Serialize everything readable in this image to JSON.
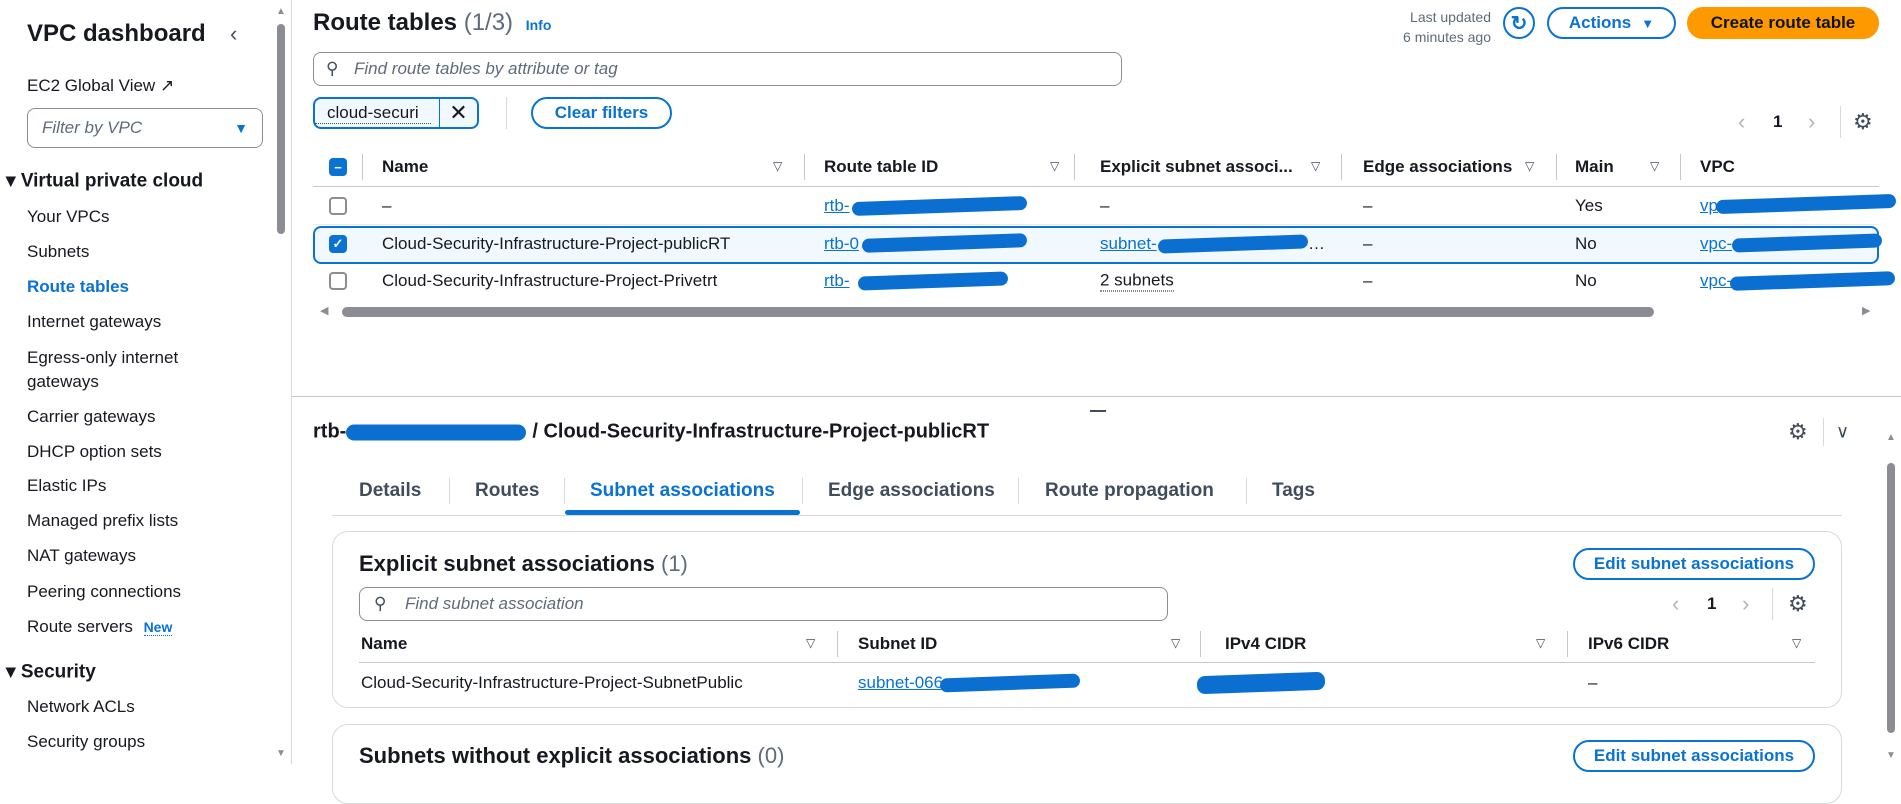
{
  "sidebar": {
    "title": "VPC dashboard",
    "ec2_global_view": "EC2 Global View",
    "filter_placeholder": "Filter by VPC",
    "section_vpc": "Virtual private cloud",
    "items": [
      "Your VPCs",
      "Subnets",
      "Route tables",
      "Internet gateways",
      "Egress-only internet",
      "gateways",
      "Carrier gateways",
      "DHCP option sets",
      "Elastic IPs",
      "Managed prefix lists",
      "NAT gateways",
      "Peering connections",
      "Route servers"
    ],
    "new_badge": "New",
    "section_security": "Security",
    "security_items": [
      "Network ACLs",
      "Security groups"
    ]
  },
  "header": {
    "title": "Route tables",
    "count": "(1/3)",
    "info": "Info",
    "last_updated_1": "Last updated",
    "last_updated_2": "6 minutes ago",
    "actions": "Actions",
    "create": "Create route table"
  },
  "search": {
    "placeholder": "Find route tables by attribute or tag"
  },
  "filter": {
    "chip": "cloud-securi",
    "clear": "Clear filters"
  },
  "pagination": {
    "page": "1"
  },
  "table": {
    "columns": [
      "Name",
      "Route table ID",
      "Explicit subnet associ...",
      "Edge associations",
      "Main",
      "VPC"
    ],
    "rows": [
      {
        "name": "–",
        "rtb": "rtb-",
        "subnet": "–",
        "edge": "–",
        "main": "Yes",
        "vpc": "vp"
      },
      {
        "name": "Cloud-Security-Infrastructure-Project-publicRT",
        "rtb": "rtb-0",
        "subnet": "subnet-",
        "edge": "–",
        "main": "No",
        "vpc": "vpc-"
      },
      {
        "name": "Cloud-Security-Infrastructure-Project-Privetrt",
        "rtb": "rtb-",
        "subnet": "2 subnets",
        "edge": "–",
        "main": "No",
        "vpc": "vpc-"
      }
    ]
  },
  "detail": {
    "id_prefix": "rtb-",
    "title": "/ Cloud-Security-Infrastructure-Project-publicRT",
    "tabs": [
      "Details",
      "Routes",
      "Subnet associations",
      "Edge associations",
      "Route propagation",
      "Tags"
    ],
    "active_tab": "Subnet associations",
    "explicit": {
      "title": "Explicit subnet associations",
      "count": "(1)",
      "edit": "Edit subnet associations",
      "search_placeholder": "Find subnet association",
      "page": "1",
      "columns": [
        "Name",
        "Subnet ID",
        "IPv4 CIDR",
        "IPv6 CIDR"
      ],
      "row": {
        "name": "Cloud-Security-Infrastructure-Project-SubnetPublic",
        "subnet": "subnet-066",
        "ipv6": "–"
      }
    },
    "without": {
      "title": "Subnets without explicit associations",
      "count": "(0)",
      "edit": "Edit subnet associations"
    }
  }
}
